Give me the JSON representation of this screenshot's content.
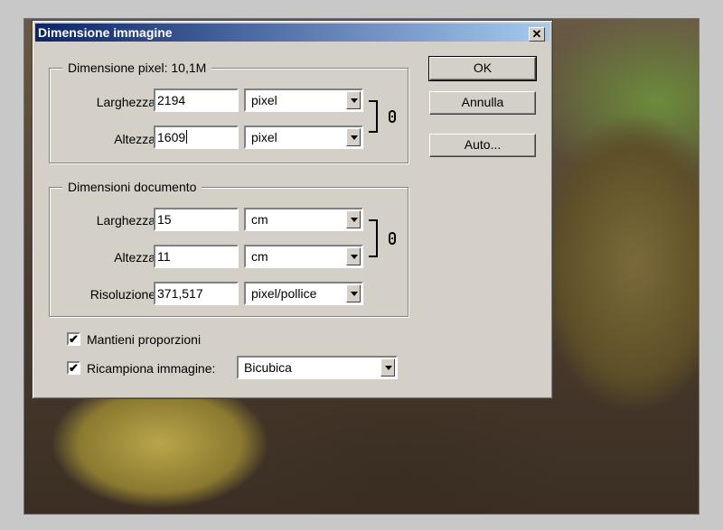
{
  "dialog": {
    "title": "Dimensione immagine",
    "close_glyph": "✕"
  },
  "pixel_dimensions": {
    "legend": "Dimensione pixel:  10,1M",
    "width_label": "Larghezza:",
    "width_value": "2194",
    "width_unit": "pixel",
    "height_label": "Altezza:",
    "height_value": "1609",
    "height_unit": "pixel"
  },
  "document_dimensions": {
    "legend": "Dimensioni documento",
    "width_label": "Larghezza:",
    "width_value": "15",
    "width_unit": "cm",
    "height_label": "Altezza:",
    "height_value": "11",
    "height_unit": "cm",
    "resolution_label": "Risoluzione:",
    "resolution_value": "371,517",
    "resolution_unit": "pixel/pollice"
  },
  "buttons": {
    "ok": "OK",
    "cancel": "Annulla",
    "auto": "Auto..."
  },
  "options": {
    "constrain_label": "Mantieni proporzioni",
    "constrain_checked": true,
    "resample_label": "Ricampiona immagine:",
    "resample_checked": true,
    "resample_method": "Bicubica",
    "check_glyph": "✔"
  },
  "icons": {
    "link": "chain-link-icon",
    "dropdown": "chevron-down-icon",
    "close": "close-icon"
  }
}
